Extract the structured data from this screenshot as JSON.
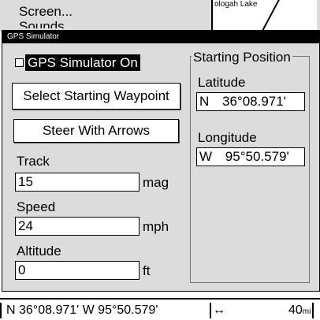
{
  "background_menu": {
    "item1": "Screen...",
    "item2": "Sounds",
    "map_label": "ologah Lake"
  },
  "dialog": {
    "title": "GPS Simulator",
    "simulator_checkbox": {
      "label": "GPS Simulator On",
      "checked": false
    },
    "select_waypoint_button": "Select Starting Waypoint",
    "steer_button": "Steer With Arrows",
    "track": {
      "label": "Track",
      "value": "15",
      "unit": "mag"
    },
    "speed": {
      "label": "Speed",
      "value": "24",
      "unit": "mph"
    },
    "altitude": {
      "label": "Altitude",
      "value": "0",
      "unit": "ft"
    },
    "starting_position": {
      "title": "Starting Position",
      "latitude_label": "Latitude",
      "latitude_hemi": "N",
      "latitude_value": "36°08.971'",
      "longitude_label": "Longitude",
      "longitude_hemi": "W",
      "longitude_value": "95°50.579'"
    }
  },
  "status_bar": {
    "position": "N  36°08.971'   W   95°50.579'",
    "scale_icon": "↔",
    "scale_value": "40",
    "scale_unit": "mi"
  }
}
